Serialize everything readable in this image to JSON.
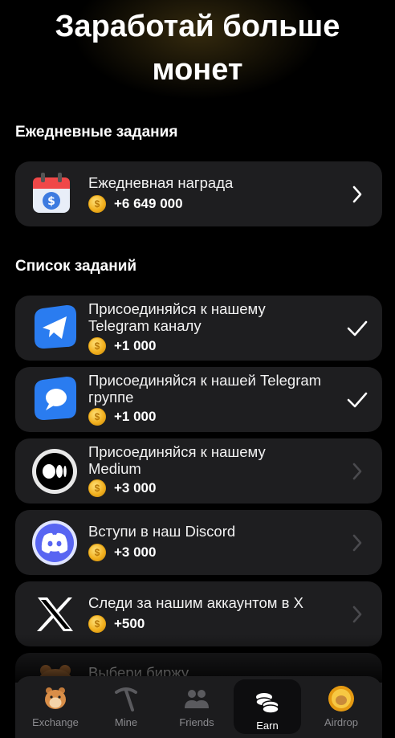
{
  "header": {
    "title_line1": "Заработай больше",
    "title_line2": "монет"
  },
  "daily": {
    "section_title": "Ежедневные задания",
    "item": {
      "title": "Ежедневная награда",
      "reward": "+6 649 000",
      "icon": "calendar-dollar-icon"
    }
  },
  "tasks": {
    "section_title": "Список заданий",
    "items": [
      {
        "title": "Присоединяйся к нашему Telegram каналу",
        "reward": "+1 000",
        "icon": "telegram-channel-icon",
        "status": "completed"
      },
      {
        "title": "Присоединяйся к нашей Telegram группе",
        "reward": "+1 000",
        "icon": "telegram-group-icon",
        "status": "completed"
      },
      {
        "title": "Присоединяйся к нашему Medium",
        "reward": "+3 000",
        "icon": "medium-icon",
        "status": "open"
      },
      {
        "title": "Вступи в наш Discord",
        "reward": "+3 000",
        "icon": "discord-icon",
        "status": "open"
      },
      {
        "title": "Следи за нашим аккаунтом в X",
        "reward": "+500",
        "icon": "x-icon",
        "status": "open"
      },
      {
        "title": "Выбери биржу",
        "reward": "",
        "icon": "hamster-icon",
        "status": "open"
      }
    ]
  },
  "tabbar": {
    "items": [
      {
        "label": "Exchange",
        "icon": "hamster-icon",
        "active": false
      },
      {
        "label": "Mine",
        "icon": "pickaxe-icon",
        "active": false
      },
      {
        "label": "Friends",
        "icon": "friends-icon",
        "active": false
      },
      {
        "label": "Earn",
        "icon": "coins-icon",
        "active": true
      },
      {
        "label": "Airdrop",
        "icon": "airdrop-coin-icon",
        "active": false
      }
    ]
  },
  "colors": {
    "background": "#000000",
    "card": "#1e1e20",
    "coin": "#f2b01e",
    "telegram_blue": "#2a7cf0",
    "discord": "#5865f2"
  }
}
